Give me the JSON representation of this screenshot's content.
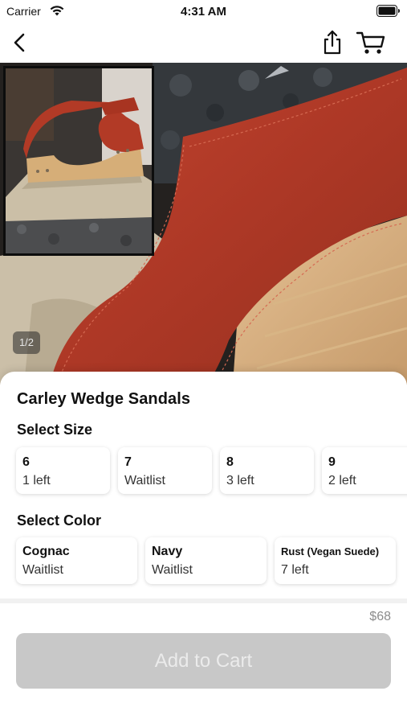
{
  "status_bar": {
    "carrier": "Carrier",
    "time": "4:31 AM"
  },
  "gallery": {
    "page_indicator": "1/2"
  },
  "product": {
    "title": "Carley Wedge Sandals",
    "price": "$68"
  },
  "sizes": {
    "label": "Select Size",
    "options": [
      {
        "size": "6",
        "availability": "1 left"
      },
      {
        "size": "7",
        "availability": "Waitlist"
      },
      {
        "size": "8",
        "availability": "3 left"
      },
      {
        "size": "9",
        "availability": "2 left"
      }
    ]
  },
  "colors": {
    "label": "Select Color",
    "options": [
      {
        "name": "Cognac",
        "availability": "Waitlist"
      },
      {
        "name": "Navy",
        "availability": "Waitlist"
      },
      {
        "name": "Rust (Vegan Suede)",
        "availability": "7 left"
      }
    ]
  },
  "actions": {
    "add_to_cart": "Add to Cart"
  },
  "icons": [
    "wifi-icon",
    "battery-icon",
    "back-chevron-icon",
    "share-icon",
    "cart-icon"
  ],
  "colors_theme": {
    "accent_disabled": "#c8c8c8",
    "price_text": "#8c8c8c",
    "product_rust": "#b23a26"
  }
}
